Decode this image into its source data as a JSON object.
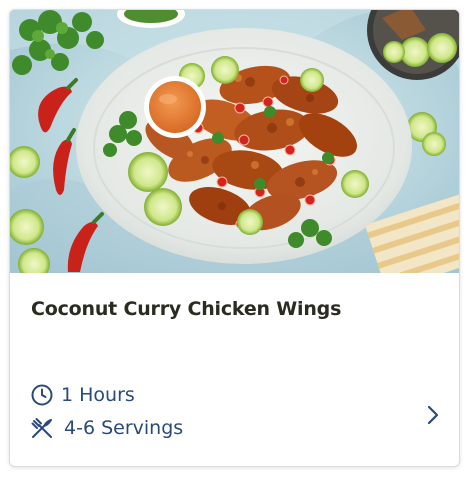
{
  "recipe": {
    "title": "Coconut Curry Chicken Wings",
    "time": "1 Hours",
    "servings": "4-6 Servings"
  },
  "colors": {
    "title": "#2b2b22",
    "meta": "#2a4a7a",
    "card_border": "#dcdcdc",
    "background": "#bcd7df"
  },
  "icons": {
    "time": "clock-icon",
    "servings": "utensils-icon",
    "open": "chevron-right-icon"
  }
}
